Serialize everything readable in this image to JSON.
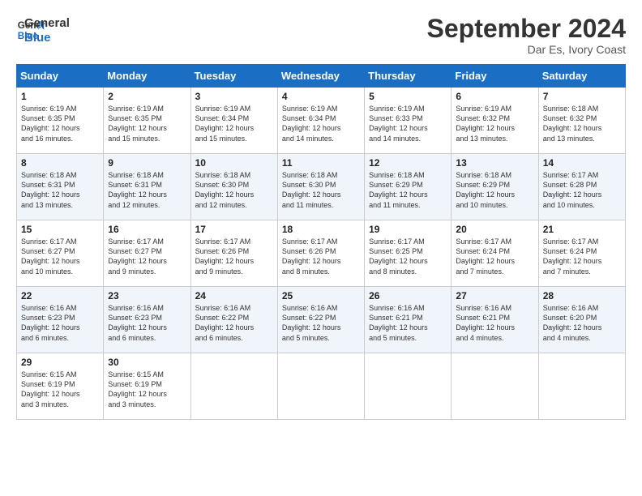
{
  "logo": {
    "line1": "General",
    "line2": "Blue"
  },
  "title": "September 2024",
  "location": "Dar Es, Ivory Coast",
  "days_of_week": [
    "Sunday",
    "Monday",
    "Tuesday",
    "Wednesday",
    "Thursday",
    "Friday",
    "Saturday"
  ],
  "weeks": [
    [
      {
        "day": "1",
        "info": "Sunrise: 6:19 AM\nSunset: 6:35 PM\nDaylight: 12 hours\nand 16 minutes."
      },
      {
        "day": "2",
        "info": "Sunrise: 6:19 AM\nSunset: 6:35 PM\nDaylight: 12 hours\nand 15 minutes."
      },
      {
        "day": "3",
        "info": "Sunrise: 6:19 AM\nSunset: 6:34 PM\nDaylight: 12 hours\nand 15 minutes."
      },
      {
        "day": "4",
        "info": "Sunrise: 6:19 AM\nSunset: 6:34 PM\nDaylight: 12 hours\nand 14 minutes."
      },
      {
        "day": "5",
        "info": "Sunrise: 6:19 AM\nSunset: 6:33 PM\nDaylight: 12 hours\nand 14 minutes."
      },
      {
        "day": "6",
        "info": "Sunrise: 6:19 AM\nSunset: 6:32 PM\nDaylight: 12 hours\nand 13 minutes."
      },
      {
        "day": "7",
        "info": "Sunrise: 6:18 AM\nSunset: 6:32 PM\nDaylight: 12 hours\nand 13 minutes."
      }
    ],
    [
      {
        "day": "8",
        "info": "Sunrise: 6:18 AM\nSunset: 6:31 PM\nDaylight: 12 hours\nand 13 minutes."
      },
      {
        "day": "9",
        "info": "Sunrise: 6:18 AM\nSunset: 6:31 PM\nDaylight: 12 hours\nand 12 minutes."
      },
      {
        "day": "10",
        "info": "Sunrise: 6:18 AM\nSunset: 6:30 PM\nDaylight: 12 hours\nand 12 minutes."
      },
      {
        "day": "11",
        "info": "Sunrise: 6:18 AM\nSunset: 6:30 PM\nDaylight: 12 hours\nand 11 minutes."
      },
      {
        "day": "12",
        "info": "Sunrise: 6:18 AM\nSunset: 6:29 PM\nDaylight: 12 hours\nand 11 minutes."
      },
      {
        "day": "13",
        "info": "Sunrise: 6:18 AM\nSunset: 6:29 PM\nDaylight: 12 hours\nand 10 minutes."
      },
      {
        "day": "14",
        "info": "Sunrise: 6:17 AM\nSunset: 6:28 PM\nDaylight: 12 hours\nand 10 minutes."
      }
    ],
    [
      {
        "day": "15",
        "info": "Sunrise: 6:17 AM\nSunset: 6:27 PM\nDaylight: 12 hours\nand 10 minutes."
      },
      {
        "day": "16",
        "info": "Sunrise: 6:17 AM\nSunset: 6:27 PM\nDaylight: 12 hours\nand 9 minutes."
      },
      {
        "day": "17",
        "info": "Sunrise: 6:17 AM\nSunset: 6:26 PM\nDaylight: 12 hours\nand 9 minutes."
      },
      {
        "day": "18",
        "info": "Sunrise: 6:17 AM\nSunset: 6:26 PM\nDaylight: 12 hours\nand 8 minutes."
      },
      {
        "day": "19",
        "info": "Sunrise: 6:17 AM\nSunset: 6:25 PM\nDaylight: 12 hours\nand 8 minutes."
      },
      {
        "day": "20",
        "info": "Sunrise: 6:17 AM\nSunset: 6:24 PM\nDaylight: 12 hours\nand 7 minutes."
      },
      {
        "day": "21",
        "info": "Sunrise: 6:17 AM\nSunset: 6:24 PM\nDaylight: 12 hours\nand 7 minutes."
      }
    ],
    [
      {
        "day": "22",
        "info": "Sunrise: 6:16 AM\nSunset: 6:23 PM\nDaylight: 12 hours\nand 6 minutes."
      },
      {
        "day": "23",
        "info": "Sunrise: 6:16 AM\nSunset: 6:23 PM\nDaylight: 12 hours\nand 6 minutes."
      },
      {
        "day": "24",
        "info": "Sunrise: 6:16 AM\nSunset: 6:22 PM\nDaylight: 12 hours\nand 6 minutes."
      },
      {
        "day": "25",
        "info": "Sunrise: 6:16 AM\nSunset: 6:22 PM\nDaylight: 12 hours\nand 5 minutes."
      },
      {
        "day": "26",
        "info": "Sunrise: 6:16 AM\nSunset: 6:21 PM\nDaylight: 12 hours\nand 5 minutes."
      },
      {
        "day": "27",
        "info": "Sunrise: 6:16 AM\nSunset: 6:21 PM\nDaylight: 12 hours\nand 4 minutes."
      },
      {
        "day": "28",
        "info": "Sunrise: 6:16 AM\nSunset: 6:20 PM\nDaylight: 12 hours\nand 4 minutes."
      }
    ],
    [
      {
        "day": "29",
        "info": "Sunrise: 6:15 AM\nSunset: 6:19 PM\nDaylight: 12 hours\nand 3 minutes."
      },
      {
        "day": "30",
        "info": "Sunrise: 6:15 AM\nSunset: 6:19 PM\nDaylight: 12 hours\nand 3 minutes."
      },
      {
        "day": "",
        "info": ""
      },
      {
        "day": "",
        "info": ""
      },
      {
        "day": "",
        "info": ""
      },
      {
        "day": "",
        "info": ""
      },
      {
        "day": "",
        "info": ""
      }
    ]
  ]
}
